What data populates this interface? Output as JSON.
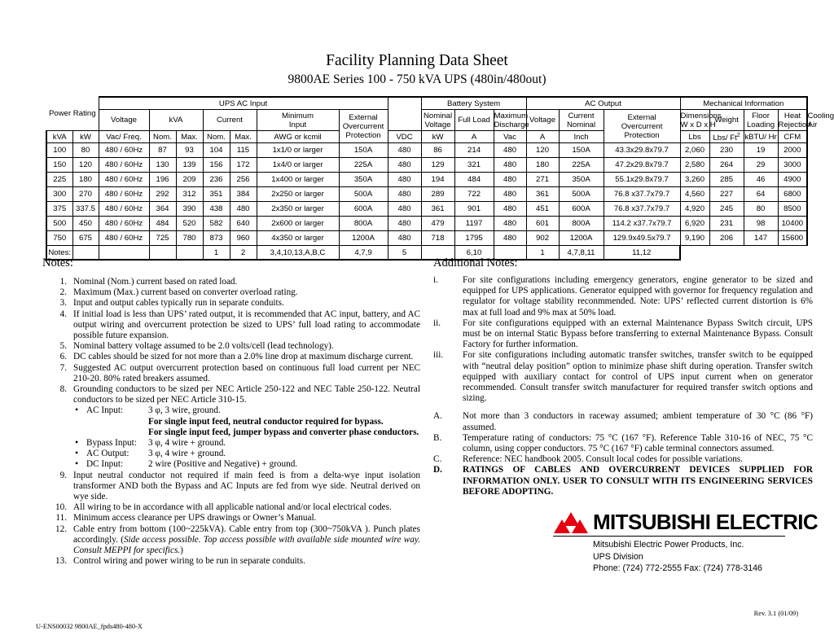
{
  "title": {
    "main": "Facility Planning Data Sheet",
    "sub": "9800AE Series 100 - 750 kVA UPS (480in/480out)"
  },
  "table": {
    "group_headers": {
      "power_rating": "Power Rating",
      "ups_ac_input": "UPS AC Input",
      "battery_system": "Battery System",
      "ac_output": "AC Output",
      "mechanical_information": "Mechanical Information"
    },
    "sub_headers": {
      "power_rating": "Power Rating",
      "voltage_in": "Voltage",
      "kva_in": "kVA",
      "current_in": "Current",
      "minimum_input": "Minimum Input",
      "external_overcurrent_in": "External Overcurrent Protection",
      "nominal_voltage": "Nominal Voltage",
      "full_load": "Full Load",
      "maximum_discharge": "Maximum Discharge",
      "voltage_out": "Voltage",
      "current_nominal": "Current Nominal",
      "external_overcurrent_out": "External Overcurrent Protection",
      "dimensions": "Dimensions W x D x H",
      "weight": "Weight",
      "floor_loading": "Floor Loading",
      "heat_rejection": "Heat Rejection",
      "cooling_air": "Cooling Air"
    },
    "unit_headers": {
      "kva": "kVA",
      "kw": "kW",
      "vac_freq": "Vac/ Freq.",
      "kva_nom": "Nom.",
      "kva_max": "Max.",
      "cur_nom": "Nom.",
      "cur_max": "Max.",
      "awg": "AWG or kcmil",
      "vdc": "VDC",
      "bat_kw": "kW",
      "bat_a": "A",
      "out_vac": "Vac",
      "out_a": "A",
      "inch": "Inch",
      "lbs": "Lbs",
      "lbs_ft2": "Lbs/ Ft",
      "lbs_ft2_sup": "2",
      "kbtu_hr": "kBTU/ Hr",
      "cfm": "CFM"
    },
    "rows": [
      {
        "kva": "100",
        "kw": "80",
        "vac_freq": "480 / 60Hz",
        "kva_nom": "87",
        "kva_max": "93",
        "cur_nom": "104",
        "cur_max": "115",
        "awg": "1x1/0 or larger",
        "ext_oc_in": "150A",
        "vdc": "480",
        "bat_kw": "86",
        "bat_a": "214",
        "out_vac": "480",
        "out_a": "120",
        "ext_oc_out": "150A",
        "dim": "43.3x29.8x79.7",
        "weight": "2,060",
        "floor": "230",
        "heat": "19",
        "cfm": "2000"
      },
      {
        "kva": "150",
        "kw": "120",
        "vac_freq": "480 / 60Hz",
        "kva_nom": "130",
        "kva_max": "139",
        "cur_nom": "156",
        "cur_max": "172",
        "awg": "1x4/0 or larger",
        "ext_oc_in": "225A",
        "vdc": "480",
        "bat_kw": "129",
        "bat_a": "321",
        "out_vac": "480",
        "out_a": "180",
        "ext_oc_out": "225A",
        "dim": "47.2x29.8x79.7",
        "weight": "2,580",
        "floor": "264",
        "heat": "29",
        "cfm": "3000"
      },
      {
        "kva": "225",
        "kw": "180",
        "vac_freq": "480 / 60Hz",
        "kva_nom": "196",
        "kva_max": "209",
        "cur_nom": "236",
        "cur_max": "256",
        "awg": "1x400 or larger",
        "ext_oc_in": "350A",
        "vdc": "480",
        "bat_kw": "194",
        "bat_a": "484",
        "out_vac": "480",
        "out_a": "271",
        "ext_oc_out": "350A",
        "dim": "55.1x29.8x79.7",
        "weight": "3,260",
        "floor": "285",
        "heat": "46",
        "cfm": "4900"
      },
      {
        "kva": "300",
        "kw": "270",
        "vac_freq": "480 / 60Hz",
        "kva_nom": "292",
        "kva_max": "312",
        "cur_nom": "351",
        "cur_max": "384",
        "awg": "2x250 or larger",
        "ext_oc_in": "500A",
        "vdc": "480",
        "bat_kw": "289",
        "bat_a": "722",
        "out_vac": "480",
        "out_a": "361",
        "ext_oc_out": "500A",
        "dim": "76.8 x37.7x79.7",
        "weight": "4,560",
        "floor": "227",
        "heat": "64",
        "cfm": "6800"
      },
      {
        "kva": "375",
        "kw": "337.5",
        "vac_freq": "480 / 60Hz",
        "kva_nom": "364",
        "kva_max": "390",
        "cur_nom": "438",
        "cur_max": "480",
        "awg": "2x350 or larger",
        "ext_oc_in": "600A",
        "vdc": "480",
        "bat_kw": "361",
        "bat_a": "901",
        "out_vac": "480",
        "out_a": "451",
        "ext_oc_out": "600A",
        "dim": "76.8 x37.7x79.7",
        "weight": "4,920",
        "floor": "245",
        "heat": "80",
        "cfm": "8500"
      },
      {
        "kva": "500",
        "kw": "450",
        "vac_freq": "480 / 60Hz",
        "kva_nom": "484",
        "kva_max": "520",
        "cur_nom": "582",
        "cur_max": "640",
        "awg": "2x600 or larger",
        "ext_oc_in": "800A",
        "vdc": "480",
        "bat_kw": "479",
        "bat_a": "1197",
        "out_vac": "480",
        "out_a": "601",
        "ext_oc_out": "800A",
        "dim": "114.2 x37.7x79.7",
        "weight": "6,920",
        "floor": "231",
        "heat": "98",
        "cfm": "10400"
      },
      {
        "kva": "750",
        "kw": "675",
        "vac_freq": "480 / 60Hz",
        "kva_nom": "725",
        "kva_max": "780",
        "cur_nom": "873",
        "cur_max": "960",
        "awg": "4x350 or larger",
        "ext_oc_in": "1200A",
        "vdc": "480",
        "bat_kw": "718",
        "bat_a": "1795",
        "out_vac": "480",
        "out_a": "902",
        "ext_oc_out": "1200A",
        "dim": "129.9x49.5x79.7",
        "weight": "9,190",
        "floor": "206",
        "heat": "147",
        "cfm": "15600"
      }
    ],
    "notes_row": {
      "label": "Notes:",
      "kva": "",
      "kw": "",
      "vac_freq": "",
      "kva_nom": "",
      "kva_max": "",
      "cur_nom": "1",
      "cur_max": "2",
      "awg": "3,4,10,13,A,B,C",
      "ext_oc_in": "4,7,9",
      "vdc": "5",
      "bat_kw": "",
      "bat_a": "6,10",
      "out_vac": "",
      "out_a": "1",
      "ext_oc_out": "4,7,8,11",
      "dim": "11,12"
    }
  },
  "notes_left": {
    "heading": "Notes:",
    "items": [
      {
        "n": "1.",
        "text": "Nominal (Nom.) current based on rated load."
      },
      {
        "n": "2.",
        "text": "Maximum (Max.) current based on converter overload rating."
      },
      {
        "n": "3.",
        "text": "Input and output cables typically run in separate conduits."
      },
      {
        "n": "4.",
        "text": "If initial load is less than UPS’ rated output, it is recommended that AC input, battery, and AC output wiring and overcurrent protection be sized to UPS’ full load rating to accommodate possible future expansion."
      },
      {
        "n": "5.",
        "text": "Nominal battery voltage assumed to be 2.0 volts/cell (lead technology)."
      },
      {
        "n": "6.",
        "text": "DC cables should be sized for not more than a 2.0% line drop at maximum discharge current."
      },
      {
        "n": "7.",
        "text": "Suggested AC output overcurrent protection based on continuous full load current per NEC 210-20. 80% rated breakers assumed."
      },
      {
        "n": "8.",
        "text": "Grounding conductors to be sized per NEC Article 250-122 and NEC Table 250-122. Neutral conductors to be sized per NEC Article 310-15."
      },
      {
        "n": "9.",
        "text": "Input neutral conductor not required if main feed is from a delta-wye input isolation transformer AND both the Bypass and AC Inputs are fed from wye side. Neutral derived on wye side."
      },
      {
        "n": "10.",
        "text": "All wiring to be in accordance with all applicable national and/or local electrical codes."
      },
      {
        "n": "11.",
        "text": "Minimum access clearance per UPS drawings or Owner’s Manual."
      },
      {
        "n": "12.",
        "text": "Cable entry from bottom (100~225kVA). Cable entry from top (300~750kVA ). Punch plates accordingly. ("
      },
      {
        "n": "13.",
        "text": "Control wiring and power wiring to be run in separate conduits."
      }
    ],
    "note12_italic": "Side access possible. Top access possible with available side mounted wire way. Consult MEPPI for specifics.",
    "note12_tail": ")",
    "bullets": [
      {
        "label": "AC Input:",
        "value": "3 φ,  3 wire, ground."
      },
      {
        "label": "Bypass Input:",
        "value": "3 φ,  4 wire + ground."
      },
      {
        "label": "AC Output:",
        "value": "3 φ,  4 wire + ground."
      },
      {
        "label": "DC Input:",
        "value": "2 wire (Positive and Negative) + ground."
      }
    ],
    "bold_lines": [
      "For single input feed, neutral conductor required for bypass.",
      "For single input feed, jumper bypass and converter phase conductors."
    ]
  },
  "notes_right": {
    "heading": "Additional Notes:",
    "roman_items": [
      {
        "n": "i.",
        "text": "For site configurations including emergency generators, engine generator to be sized and equipped for UPS applications. Generator equipped with governor for frequency regulation and regulator for voltage stability reconmmended. Note: UPS’ reflected current distortion is 6% max at full load and 9% max at 50% load."
      },
      {
        "n": "ii.",
        "text": "For site configurations equipped with an external Maintenance Bypass Switch circuit, UPS must be on internal Static Bypass before transferring to external Maintenance Bypass. Consult Factory for further information."
      },
      {
        "n": "iii.",
        "text": "For site configurations including automatic transfer switches, transfer switch to be equipped with “neutral delay position” option to minimize phase shift during operation. Transfer switch equipped with auxiliary contact for control of UPS input current when on generator recommended. Consult transfer switch manufacturer for required transfer switch options and sizing."
      }
    ],
    "alpha_items": [
      {
        "n": "A.",
        "text": "Not more than 3 conductors in raceway assumed; ambient temperature of 30 °C (86 °F) assumed.",
        "bold": false
      },
      {
        "n": "B.",
        "text": "Temperature rating of conductors: 75 °C (167 °F). Reference Table 310-16 of NEC, 75 °C column, using copper conductors. 75 °C (167 °F) cable terminal connectors assumed.",
        "bold": false
      },
      {
        "n": "C.",
        "text": "Reference: NEC handbook 2005. Consult local codes for possible variations.",
        "bold": false
      },
      {
        "n": "D.",
        "text": "RATINGS OF CABLES AND OVERCURRENT DEVICES SUPPLIED FOR INFORMATION ONLY. USER TO CONSULT WITH ITS ENGINEERING SERVICES BEFORE ADOPTING.",
        "bold": true
      }
    ]
  },
  "logo": {
    "brand": "MITSUBISHI ELECTRIC",
    "company": "Mitsubishi Electric Power Products, Inc.",
    "division": "UPS Division",
    "contact": "Phone: (724) 772-2555   Fax: (724) 778-3146",
    "mark_color": "#E60012"
  },
  "footer": {
    "revision": "Rev. 3.1 (01/09)",
    "doc_code": "U-ENS00032 9800AE_fpds480-480-X"
  }
}
